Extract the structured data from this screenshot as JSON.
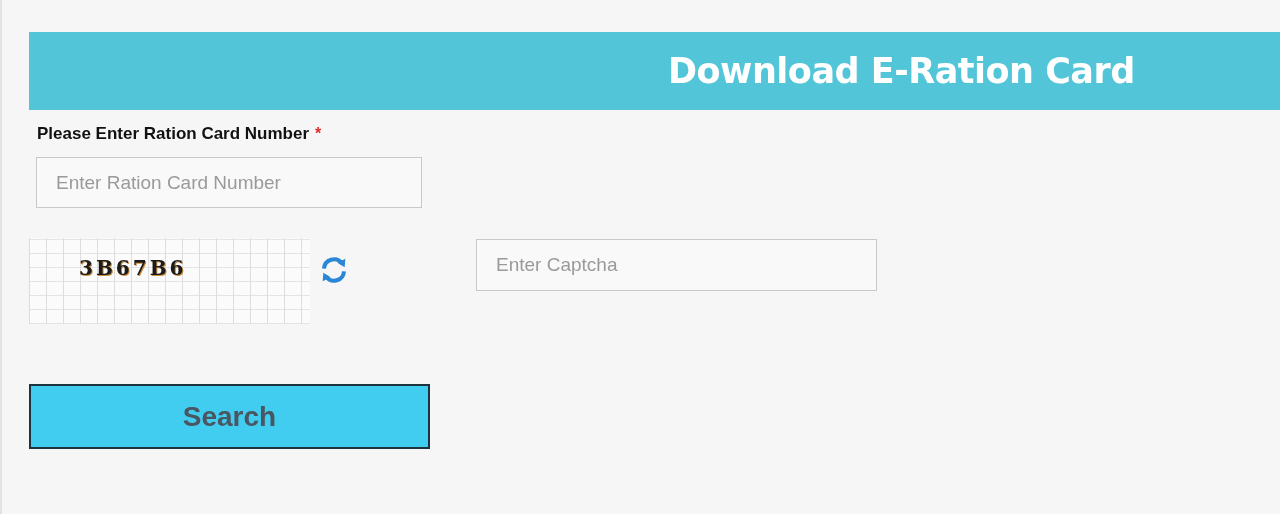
{
  "header": {
    "title": "Download E-Ration Card"
  },
  "ration_field": {
    "label": "Please Enter Ration Card Number",
    "required_mark": "*",
    "placeholder": "Enter Ration Card Number"
  },
  "captcha": {
    "code": "3B67B6",
    "placeholder": "Enter Captcha"
  },
  "search_button": {
    "label": "Search"
  }
}
